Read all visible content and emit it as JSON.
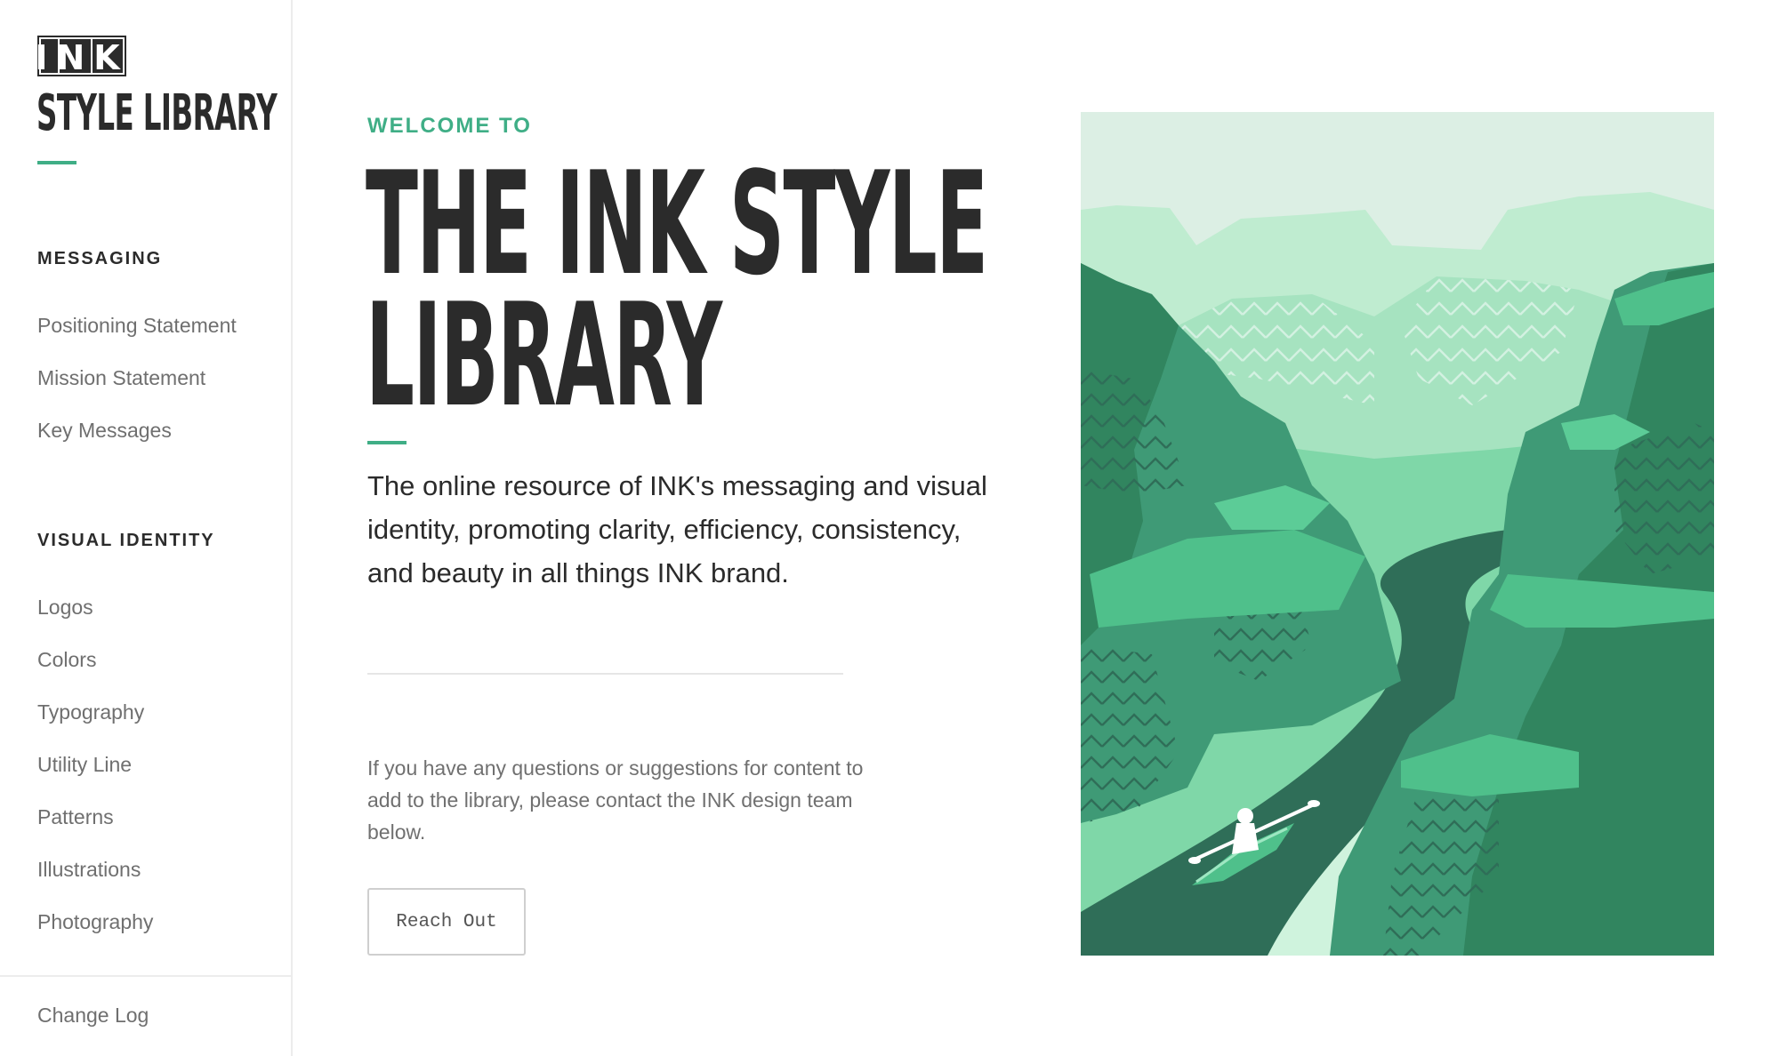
{
  "sidebar": {
    "logo_text": "INK",
    "title": "STYLE LIBRARY",
    "sections": [
      {
        "heading": "MESSAGING",
        "items": [
          "Positioning Statement",
          "Mission Statement",
          "Key Messages"
        ]
      },
      {
        "heading": "VISUAL IDENTITY",
        "items": [
          "Logos",
          "Colors",
          "Typography",
          "Utility Line",
          "Patterns",
          "Illustrations",
          "Photography"
        ]
      }
    ],
    "footer_item": "Change Log"
  },
  "main": {
    "eyebrow": "WELCOME TO",
    "headline_line1": "THE INK STYLE",
    "headline_line2": "LIBRARY",
    "lede": "The online resource of INK's messaging and visual identity, promoting clarity, efficiency, consistency, and beauty in all things INK brand.",
    "contact_text": "If you have any questions or suggestions for content to add to the library, please contact the INK design team below.",
    "reach_out_label": "Reach Out"
  },
  "colors": {
    "accent": "#3fae86",
    "text_dark": "#2b2b2b",
    "text_muted": "#6f6f6f"
  }
}
